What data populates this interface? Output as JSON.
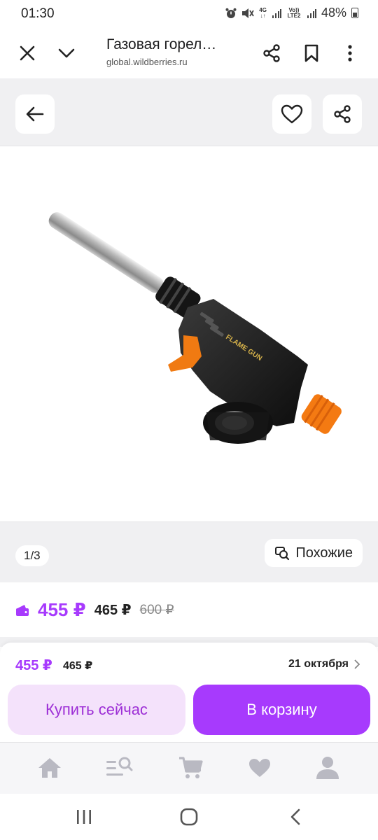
{
  "status_bar": {
    "time": "01:30",
    "network_label": "4G",
    "volte_label": "Vo)) LTE2",
    "battery_percent": "48%",
    "icons": [
      "alarm-icon",
      "mute-icon",
      "data-arrows-icon",
      "signal-icon",
      "signal-icon",
      "battery-icon"
    ]
  },
  "browser": {
    "page_title": "Газовая горел…",
    "url": "global.wildberries.ru",
    "icons": [
      "close-icon",
      "chevron-down-icon",
      "share-icon",
      "bookmark-icon",
      "more-icon"
    ]
  },
  "gallery": {
    "counter": "1/3",
    "similar_label": "Похожие",
    "image_logo_text": "FLAME GUN",
    "icons": [
      "back-arrow-icon",
      "heart-icon",
      "share-icon",
      "similar-search-icon"
    ]
  },
  "prices": {
    "main": "455 ₽",
    "secondary": "465 ₽",
    "old": "600 ₽",
    "accent_color": "#a73afd",
    "icons": [
      "wallet-icon"
    ]
  },
  "buy_panel": {
    "price": "455 ₽",
    "price_secondary": "465 ₽",
    "delivery_date": "21 октября",
    "buy_now_label": "Купить сейчас",
    "add_to_cart_label": "В корзину",
    "icons": [
      "chevron-right-icon"
    ]
  },
  "tab_bar": {
    "icons": [
      "home-icon",
      "catalog-search-icon",
      "cart-icon",
      "favorites-heart-icon",
      "profile-icon"
    ]
  },
  "system_nav": {
    "icons": [
      "recents-icon",
      "home-circle-icon",
      "back-chevron-icon"
    ]
  }
}
